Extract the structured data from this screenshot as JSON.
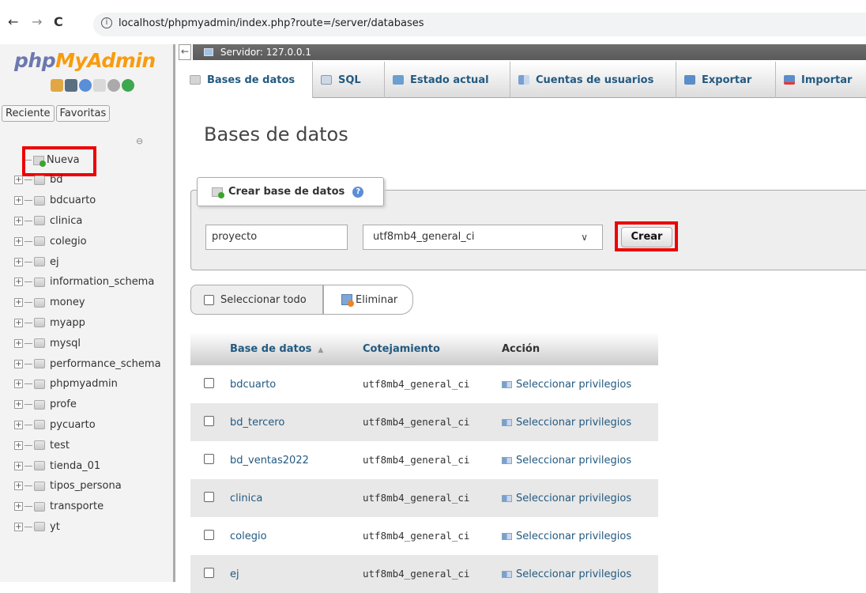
{
  "browser": {
    "url": "localhost/phpmyadmin/index.php?route=/server/databases",
    "back": "←",
    "forward": "→",
    "reload": "C",
    "info": "i"
  },
  "sidebar": {
    "logo_part1": "php",
    "logo_part2": "MyAdmin",
    "tab_recent": "Reciente",
    "tab_favorites": "Favoritas",
    "new_label": "Nueva",
    "databases": [
      "bd",
      "bdcuarto",
      "clinica",
      "colegio",
      "ej",
      "information_schema",
      "money",
      "myapp",
      "mysql",
      "performance_schema",
      "phpmyadmin",
      "profe",
      "pycuarto",
      "test",
      "tienda_01",
      "tipos_persona",
      "transporte",
      "yt"
    ]
  },
  "serverbar": {
    "label": "Servidor: 127.0.0.1"
  },
  "topmenu": {
    "tabs": [
      "Bases de datos",
      "SQL",
      "Estado actual",
      "Cuentas de usuarios",
      "Exportar",
      "Importar"
    ]
  },
  "main": {
    "title": "Bases de datos",
    "create_legend": "Crear base de datos",
    "db_name_value": "proyecto",
    "collation_value": "utf8mb4_general_ci",
    "create_button": "Crear",
    "select_all": "Seleccionar todo",
    "delete_button": "Eliminar"
  },
  "table": {
    "headers": [
      "Base de datos",
      "Cotejamiento",
      "Acción"
    ],
    "rows": [
      {
        "name": "bdcuarto",
        "collation": "utf8mb4_general_ci",
        "action": "Seleccionar privilegios"
      },
      {
        "name": "bd_tercero",
        "collation": "utf8mb4_general_ci",
        "action": "Seleccionar privilegios"
      },
      {
        "name": "bd_ventas2022",
        "collation": "utf8mb4_general_ci",
        "action": "Seleccionar privilegios"
      },
      {
        "name": "clinica",
        "collation": "utf8mb4_general_ci",
        "action": "Seleccionar privilegios"
      },
      {
        "name": "colegio",
        "collation": "utf8mb4_general_ci",
        "action": "Seleccionar privilegios"
      },
      {
        "name": "ej",
        "collation": "utf8mb4_general_ci",
        "action": "Seleccionar privilegios"
      }
    ]
  },
  "colors": {
    "accent_link": "#235a81",
    "highlight_box": "#e00000",
    "logo_blue": "#6c78af",
    "logo_orange": "#f89c0e"
  }
}
